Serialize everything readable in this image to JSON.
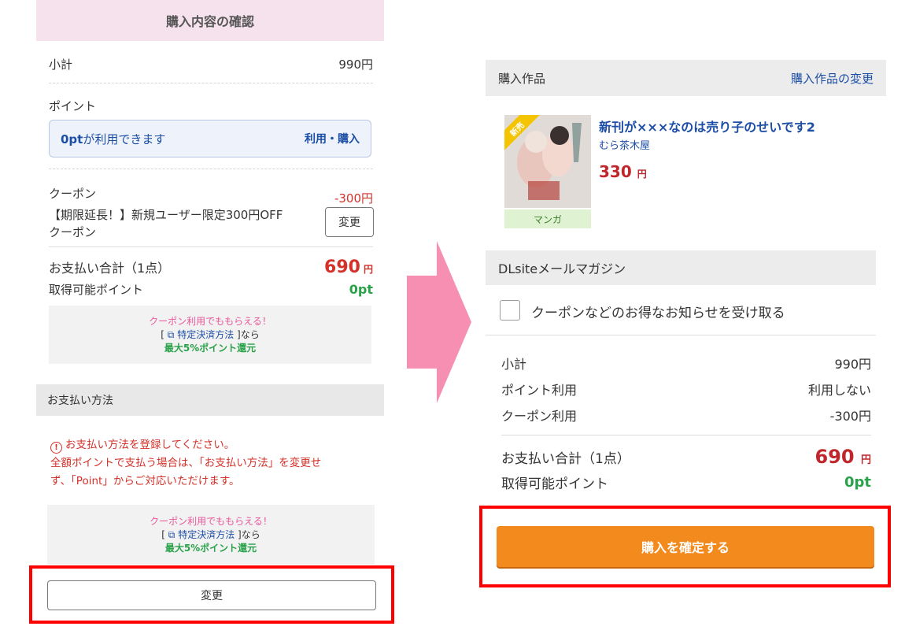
{
  "left": {
    "header": "購入内容の確認",
    "subtotal_label": "小計",
    "subtotal_value": "990円",
    "points_label": "ポイント",
    "points_amount": "0pt",
    "points_available": "が利用できます",
    "points_action": "利用・購入",
    "coupon_label": "クーポン",
    "coupon_value": "-300円",
    "coupon_name_line1": "【期限延長！】新規ユーザー限定300円OFF",
    "coupon_name_line2": "クーポン",
    "coupon_change": "変更",
    "total_label": "お支払い合計（1点）",
    "total_value": "690",
    "total_unit": "円",
    "earn_label": "取得可能ポイント",
    "earn_value": "0pt",
    "promo": {
      "line1": "クーポン利用でももらえる！",
      "bracket_open": "[",
      "method_link": "特定決済方法",
      "bracket_close": "]なら",
      "bonus": "最大5%ポイント還元"
    },
    "payment_header": "お支払い方法",
    "notice_line1": "お支払い方法を登録してください。",
    "notice_line2": "全額ポイントで支払う場合は、「お支払い方法」を変更せ",
    "notice_line3": "ず、「Point」からご対応いただけます。",
    "payment_change": "変更"
  },
  "right": {
    "works_label": "購入作品",
    "works_change": "購入作品の変更",
    "badge": "新売",
    "item_title": "新刊が×××なのは売り子のせいです2",
    "item_circle": "むら茶木屋",
    "item_price": "330",
    "item_price_unit": "円",
    "item_genre": "マンガ",
    "magazine_label": "DLsiteメールマガジン",
    "magazine_opt": "クーポンなどのお得なお知らせを受け取る",
    "subtotal_label": "小計",
    "subtotal_value": "990円",
    "point_use_label": "ポイント利用",
    "point_use_value": "利用しない",
    "coupon_use_label": "クーポン利用",
    "coupon_use_value": "-300円",
    "total_label": "お支払い合計（1点）",
    "total_value": "690",
    "total_unit": "円",
    "earn_label": "取得可能ポイント",
    "earn_value": "0pt",
    "confirm_button": "購入を確定する"
  },
  "colors": {
    "accent_pink": "#f4a6c8",
    "header_pink": "#f6e2ec",
    "link_blue": "#1d4ea6",
    "price_red": "#c0272d",
    "point_green": "#2aa24a",
    "confirm_orange": "#f28a1e",
    "highlight_red": "#ff0000"
  },
  "icons": [
    "external-link-icon",
    "alert-circle-icon",
    "checkbox-icon",
    "right-arrow-icon"
  ]
}
